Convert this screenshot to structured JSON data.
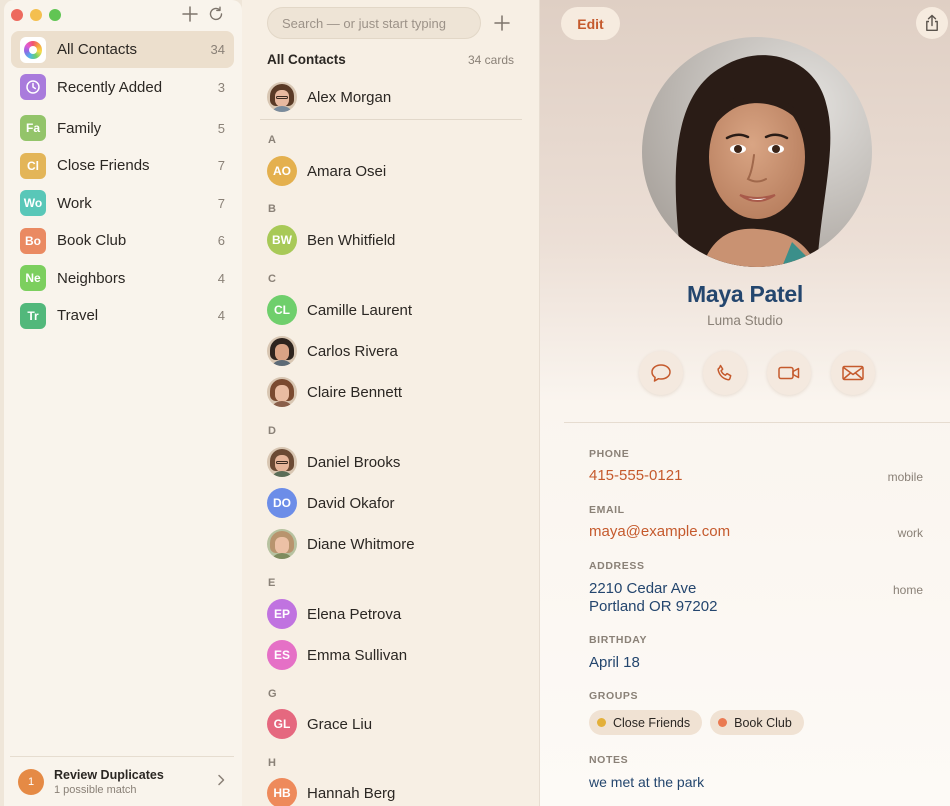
{
  "sidebar": {
    "groups": [
      {
        "label": "All Contacts",
        "count": "34",
        "abbr": "",
        "color": "#ffffff"
      },
      {
        "label": "Recently Added",
        "count": "3",
        "abbr": "",
        "color": "#a97bdc"
      },
      {
        "label": "Family",
        "count": "5",
        "abbr": "Fa",
        "color": "#93c46a"
      },
      {
        "label": "Close Friends",
        "count": "7",
        "abbr": "Cl",
        "color": "#e3b558"
      },
      {
        "label": "Work",
        "count": "7",
        "abbr": "Wo",
        "color": "#59c7b8"
      },
      {
        "label": "Book Club",
        "count": "6",
        "abbr": "Bo",
        "color": "#ea8a62"
      },
      {
        "label": "Neighbors",
        "count": "4",
        "abbr": "Ne",
        "color": "#7ccf5e"
      },
      {
        "label": "Travel",
        "count": "4",
        "abbr": "Tr",
        "color": "#52b87b"
      }
    ],
    "review": {
      "badge": "1",
      "title": "Review Duplicates",
      "subtitle": "1 possible match"
    }
  },
  "list": {
    "search_placeholder": "Search — or just start typing",
    "title": "All Contacts",
    "count": "34 cards",
    "me": "Alex Morgan",
    "sections": [
      "A",
      "B",
      "C",
      "D",
      "E",
      "G",
      "H"
    ],
    "contacts": [
      {
        "name": "Amara Osei",
        "initials": "AO",
        "color": "#e4b04e"
      },
      {
        "name": "Ben Whitfield",
        "initials": "BW",
        "color": "#a8c957"
      },
      {
        "name": "Camille Laurent",
        "initials": "CL",
        "color": "#6fcf6c"
      },
      {
        "name": "Carlos Rivera",
        "initials": "",
        "color": ""
      },
      {
        "name": "Claire Bennett",
        "initials": "",
        "color": ""
      },
      {
        "name": "Daniel Brooks",
        "initials": "",
        "color": ""
      },
      {
        "name": "David Okafor",
        "initials": "DO",
        "color": "#6c8de8"
      },
      {
        "name": "Diane Whitmore",
        "initials": "",
        "color": ""
      },
      {
        "name": "Elena Petrova",
        "initials": "EP",
        "color": "#c073e0"
      },
      {
        "name": "Emma Sullivan",
        "initials": "ES",
        "color": "#e570c6"
      },
      {
        "name": "Grace Liu",
        "initials": "GL",
        "color": "#e5687f"
      },
      {
        "name": "Hannah Berg",
        "initials": "HB",
        "color": "#ee8a5b"
      }
    ]
  },
  "detail": {
    "edit_label": "Edit",
    "name": "Maya Patel",
    "company": "Luma Studio",
    "fields": {
      "phone_label": "PHONE",
      "phone_value": "415-555-0121",
      "phone_tag": "mobile",
      "email_label": "EMAIL",
      "email_value": "maya@example.com",
      "email_tag": "work",
      "address_label": "ADDRESS",
      "address_line1": "2210 Cedar Ave",
      "address_line2": "Portland OR 97202",
      "address_tag": "home",
      "birthday_label": "BIRTHDAY",
      "birthday_value": "April 18",
      "groups_label": "GROUPS",
      "notes_label": "NOTES",
      "notes_value": "we met at the park"
    },
    "group_chips": [
      {
        "label": "Close Friends",
        "color": "#e3b03a"
      },
      {
        "label": "Book Club",
        "color": "#ea7a52"
      }
    ]
  },
  "colors": {
    "accent": "#c55a2d",
    "name_navy": "#24466e"
  }
}
